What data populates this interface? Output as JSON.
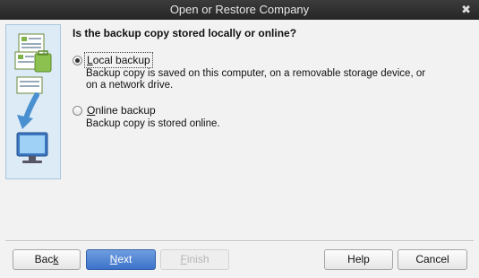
{
  "window": {
    "title": "Open or Restore Company",
    "close_glyph": "✖"
  },
  "question": "Is the backup copy stored locally or online?",
  "options": [
    {
      "label_mnemonic": "L",
      "label_rest": "ocal backup",
      "checked": true,
      "description": "Backup copy is saved on this computer, on a removable storage device, or on a network drive."
    },
    {
      "label_mnemonic": "O",
      "label_rest": "nline backup",
      "checked": false,
      "description": "Backup copy is stored online."
    }
  ],
  "buttons": {
    "back": {
      "pre": "Bac",
      "mnemonic": "k",
      "post": ""
    },
    "next": {
      "pre": "",
      "mnemonic": "N",
      "post": "ext"
    },
    "finish": {
      "pre": "",
      "mnemonic": "F",
      "post": "inish"
    },
    "help": {
      "label": "Help"
    },
    "cancel": {
      "label": "Cancel"
    }
  },
  "icons": {
    "side_panel": [
      "document-stack-icon",
      "arrow-down-icon",
      "computer-monitor-icon"
    ],
    "colors": {
      "panel_bg": "#dcebf6",
      "doc_green": "#7fb34a",
      "arrow_blue": "#4a8fd0",
      "monitor_blue": "#3b76c0"
    }
  }
}
